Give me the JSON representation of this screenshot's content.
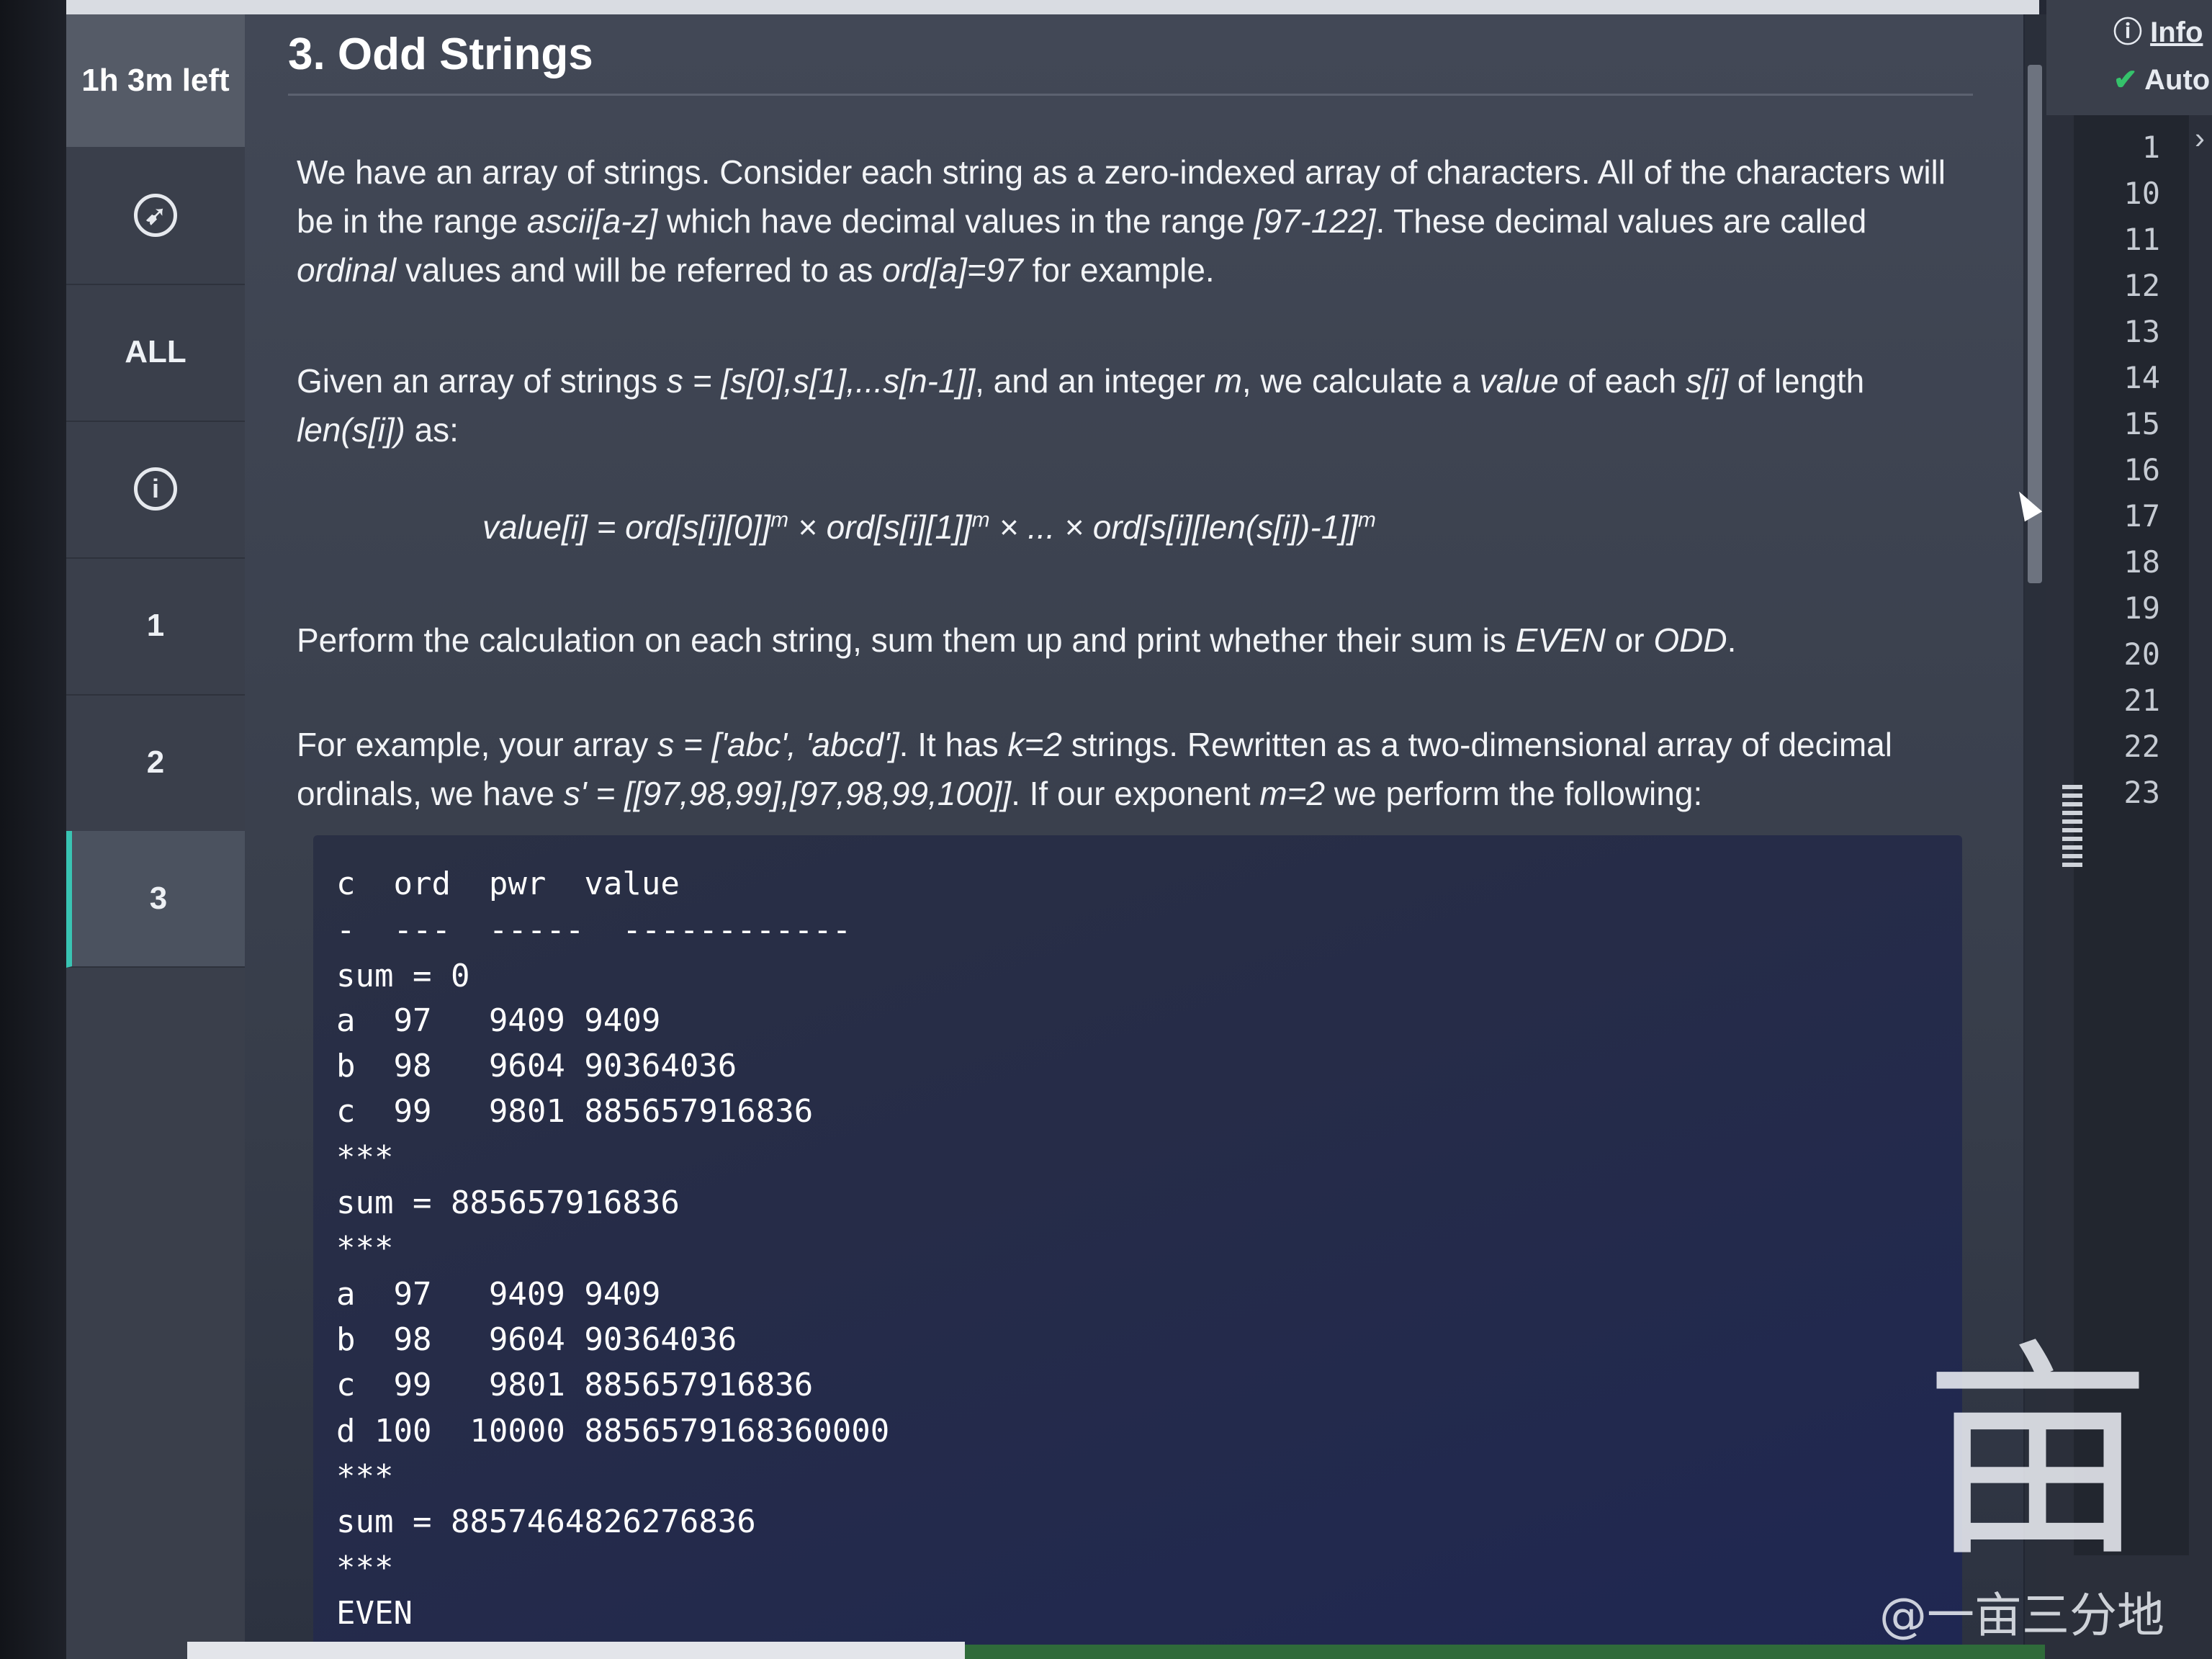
{
  "sidebar": {
    "timer": "1h 3m left",
    "items": [
      {
        "label": "ALL"
      },
      {
        "label": "1"
      },
      {
        "label": "2"
      },
      {
        "label": "3",
        "active": true
      }
    ]
  },
  "problem": {
    "title": "3. Odd Strings",
    "p1": {
      "a": "We have an array of strings. Consider each string as a zero-indexed array of characters. All of the characters will be in the range ",
      "b": "ascii[a-z]",
      "c": " which have decimal values in the range ",
      "d": "[97-122]",
      "e": ". These decimal values are called ",
      "f": "ordinal",
      "g": " values and will be referred to as ",
      "h": "ord[a]=97",
      "i": " for example."
    },
    "p2": {
      "a": "Given an array of strings ",
      "b": "s = [s[0],s[1],...s[n-1]]",
      "c": ", and an integer ",
      "d": "m",
      "e": ", we calculate a ",
      "f": "value",
      "g": " of each ",
      "h": "s[i]",
      "i": " of length ",
      "j": "len(s[i])",
      "k": " as:"
    },
    "formula": {
      "t1": "value[i] = ord[s[i][0]]",
      "t2": " × ord[s[i][1]]",
      "t3": " × ... × ord[s[i][len(s[i])-1]]",
      "exp": "m"
    },
    "p3": {
      "a": "Perform the calculation on each string, sum them up and print whether their sum is ",
      "b": "EVEN",
      "c": " or ",
      "d": "ODD",
      "e": "."
    },
    "p4": {
      "a": "For example, your array ",
      "b": "s = ['abc', 'abcd']",
      "c": ". It has ",
      "d": "k=2",
      "e": " strings. Rewritten as a two-dimensional array of decimal ordinals, we have ",
      "f": "s' = [[97,98,99],[97,98,99,100]]",
      "g": ". If our exponent ",
      "h": "m=2",
      "i": " we perform the following:"
    },
    "code_lines": [
      "c  ord  pwr  value",
      "-  ---  -----  ------------",
      "sum = 0",
      "a  97   9409 9409",
      "b  98   9604 90364036",
      "c  99   9801 885657916836",
      "***",
      "sum = 885657916836",
      "***",
      "a  97   9409 9409",
      "b  98   9604 90364036",
      "c  99   9801 885657916836",
      "d 100  10000 8856579168360000",
      "***",
      "sum = 8857464826276836",
      "***",
      "EVEN"
    ]
  },
  "right_panel": {
    "info_label": "Info",
    "auto_label": "Auto",
    "line_numbers": [
      "1",
      "10",
      "11",
      "12",
      "13",
      "14",
      "15",
      "16",
      "17",
      "18",
      "19",
      "20",
      "21",
      "22",
      "23"
    ]
  },
  "watermark": {
    "text": "@一亩三分地",
    "logo_char": "亩"
  },
  "colors": {
    "accent": "#39c4b3",
    "check": "#35c26b"
  }
}
